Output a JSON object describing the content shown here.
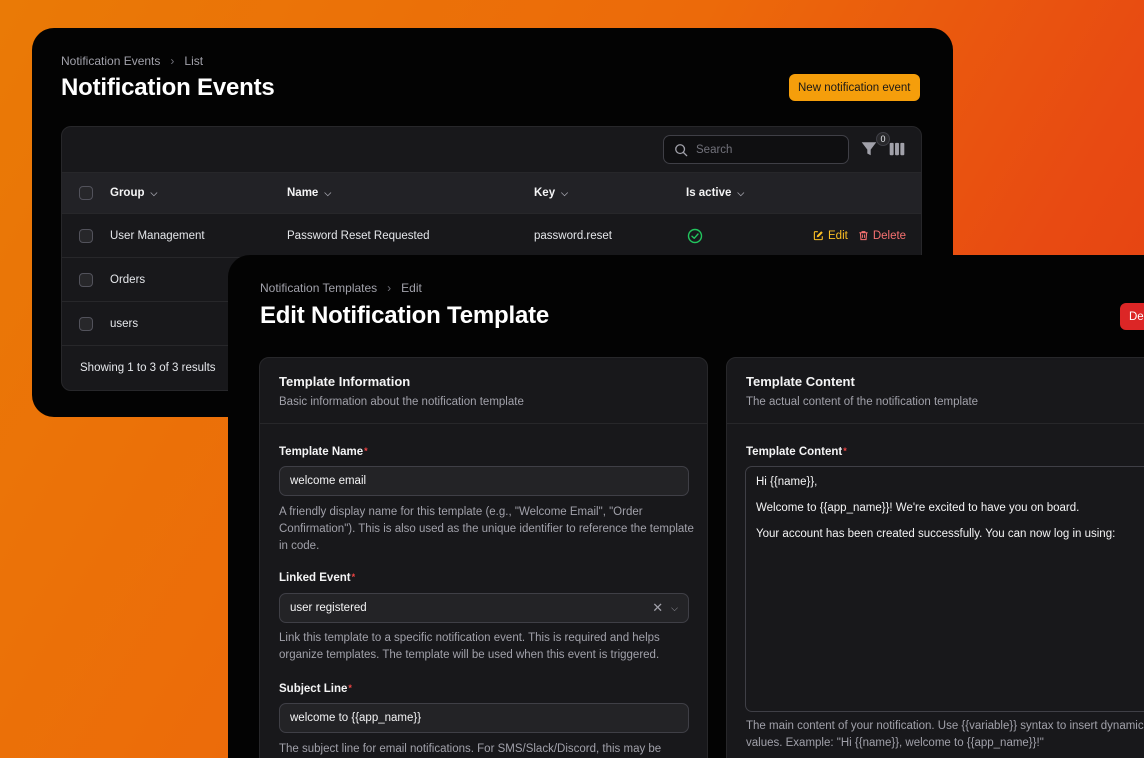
{
  "events_page": {
    "breadcrumb": [
      "Notification Events",
      "List"
    ],
    "title": "Notification Events",
    "new_button": "New notification event",
    "search_placeholder": "Search",
    "filter_count": "0",
    "columns": [
      "Group",
      "Name",
      "Key",
      "Is active"
    ],
    "rows": [
      {
        "group": "User Management",
        "name": "Password Reset Requested",
        "key": "password.reset",
        "active": true
      },
      {
        "group": "Orders",
        "name": "",
        "key": "",
        "active": null
      },
      {
        "group": "users",
        "name": "",
        "key": "",
        "active": null
      }
    ],
    "edit_label": "Edit",
    "delete_label": "Delete",
    "footer": "Showing 1 to 3 of 3 results"
  },
  "template_page": {
    "breadcrumb": [
      "Notification Templates",
      "Edit"
    ],
    "title": "Edit Notification Template",
    "delete_button": "Delete",
    "info_section": {
      "title": "Template Information",
      "description": "Basic information about the notification template",
      "name_label": "Template Name",
      "name_value": "welcome email",
      "name_help": "A friendly display name for this template (e.g., \"Welcome Email\", \"Order Confirmation\"). This is also used as the unique identifier to reference the template in code.",
      "event_label": "Linked Event",
      "event_value": "user registered",
      "event_help": "Link this template to a specific notification event. This is required and helps organize templates. The template will be used when this event is triggered.",
      "subject_label": "Subject Line",
      "subject_value": "welcome to {{app_name}}",
      "subject_help": "The subject line for email notifications. For SMS/Slack/Discord, this may be"
    },
    "content_section": {
      "title": "Template Content",
      "description": "The actual content of the notification template",
      "content_label": "Template Content",
      "content_value": "Hi {{name}},\n\nWelcome to {{app_name}}! We're excited to have you on board.\n\nYour account has been created successfully. You can now log in using:",
      "content_help": "The main content of your notification. Use {{variable}} syntax to insert dynamic values. Example: \"Hi {{name}}, welcome to {{app_name}}!\""
    }
  },
  "colors": {
    "accent": "#f59e0b",
    "danger": "#dc2626",
    "success": "#22c55e",
    "surface": "#18181b",
    "window": "#030303"
  }
}
